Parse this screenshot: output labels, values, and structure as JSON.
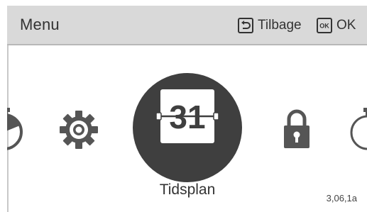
{
  "header": {
    "title": "Menu",
    "back_label": "Tilbage",
    "ok_icon_text": "OK",
    "ok_label": "OK"
  },
  "carousel": {
    "selected_label": "Tidsplan",
    "selected_date": "31",
    "items": [
      {
        "icon": "stopwatch-icon",
        "state": "partial-left"
      },
      {
        "icon": "gear-icon",
        "state": "normal"
      },
      {
        "icon": "calendar-icon",
        "state": "selected"
      },
      {
        "icon": "lock-icon",
        "state": "normal"
      },
      {
        "icon": "timer-icon",
        "state": "partial-right"
      }
    ]
  },
  "figure_ref": "3,06,1a",
  "colors": {
    "header_bg": "#d9d9d9",
    "icon_gray": "#555555",
    "selected_bg": "#3f3f3f",
    "selected_card": "#ffffff",
    "text": "#333333"
  }
}
